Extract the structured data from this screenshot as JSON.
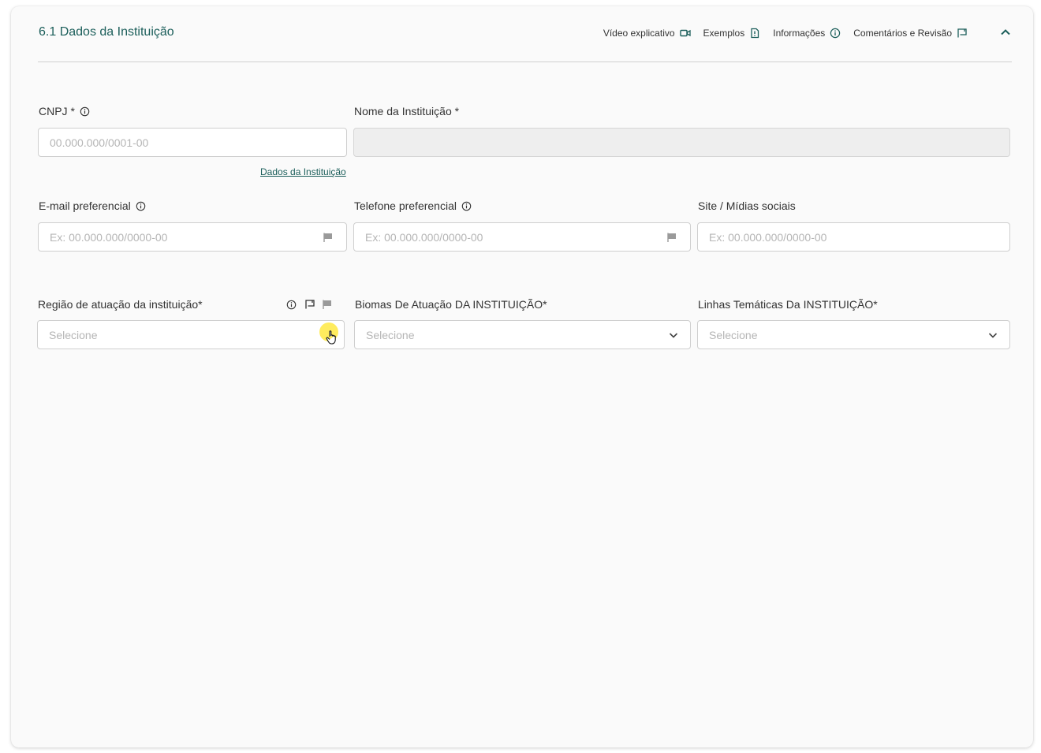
{
  "section": {
    "title": "6.1 Dados da Instituição",
    "actions": [
      {
        "label": "Vídeo explicativo",
        "icon": "video-icon"
      },
      {
        "label": "Exemplos",
        "icon": "document-icon"
      },
      {
        "label": "Informações",
        "icon": "info-icon"
      },
      {
        "label": "Comentários e Revisão",
        "icon": "comment-icon"
      }
    ],
    "collapse_icon": "chevron-up-icon"
  },
  "fields": {
    "cnpj": {
      "label": "CNPJ *",
      "placeholder": "00.000.000/0001-00",
      "value": ""
    },
    "nome": {
      "label": "Nome da Instituição *",
      "value": ""
    },
    "dados_link": "Dados da Instituição",
    "email": {
      "label": "E-mail preferencial",
      "placeholder": "Ex: 00.000.000/0000-00"
    },
    "telefone": {
      "label": "Telefone preferencial",
      "placeholder": "Ex: 00.000.000/0000-00"
    },
    "site": {
      "label": "Site / Mídias sociais",
      "placeholder": "Ex: 00.000.000/0000-00"
    },
    "regiao": {
      "label": "Região de atuação da instituição*",
      "placeholder": "Selecione"
    },
    "biomas": {
      "label": "Biomas De Atuação DA INSTITUIÇÃO*",
      "placeholder": "Selecione"
    },
    "linhas": {
      "label": "Linhas Temáticas Da INSTITUIÇÃO*",
      "placeholder": "Selecione"
    }
  },
  "colors": {
    "accent": "#1b5e5a",
    "border": "#cfcfcf",
    "placeholder": "#b5b5b5"
  }
}
